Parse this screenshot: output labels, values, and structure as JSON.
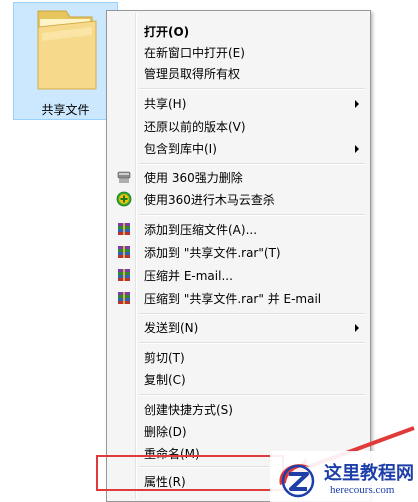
{
  "folder": {
    "label": "共享文件"
  },
  "menu": {
    "items": [
      {
        "label": "打开(O)"
      },
      {
        "label": "在新窗口中打开(E)"
      },
      {
        "label": "管理员取得所有权"
      },
      {
        "label": "共享(H)"
      },
      {
        "label": "还原以前的版本(V)"
      },
      {
        "label": "包含到库中(I)"
      },
      {
        "label": "使用 360强力删除"
      },
      {
        "label": "使用360进行木马云查杀"
      },
      {
        "label": "添加到压缩文件(A)..."
      },
      {
        "label": "添加到 \"共享文件.rar\"(T)"
      },
      {
        "label": "压缩并 E-mail..."
      },
      {
        "label": "压缩到 \"共享文件.rar\" 并 E-mail"
      },
      {
        "label": "发送到(N)"
      },
      {
        "label": "剪切(T)"
      },
      {
        "label": "复制(C)"
      },
      {
        "label": "创建快捷方式(S)"
      },
      {
        "label": "删除(D)"
      },
      {
        "label": "重命名(M)"
      },
      {
        "label": "属性(R)"
      }
    ]
  },
  "watermark": {
    "title": "这里教程网",
    "url": "herecours.com"
  },
  "colors": {
    "highlight": "#e03a3a",
    "selection": "#cce8ff",
    "brand": "#1e3fa8"
  }
}
